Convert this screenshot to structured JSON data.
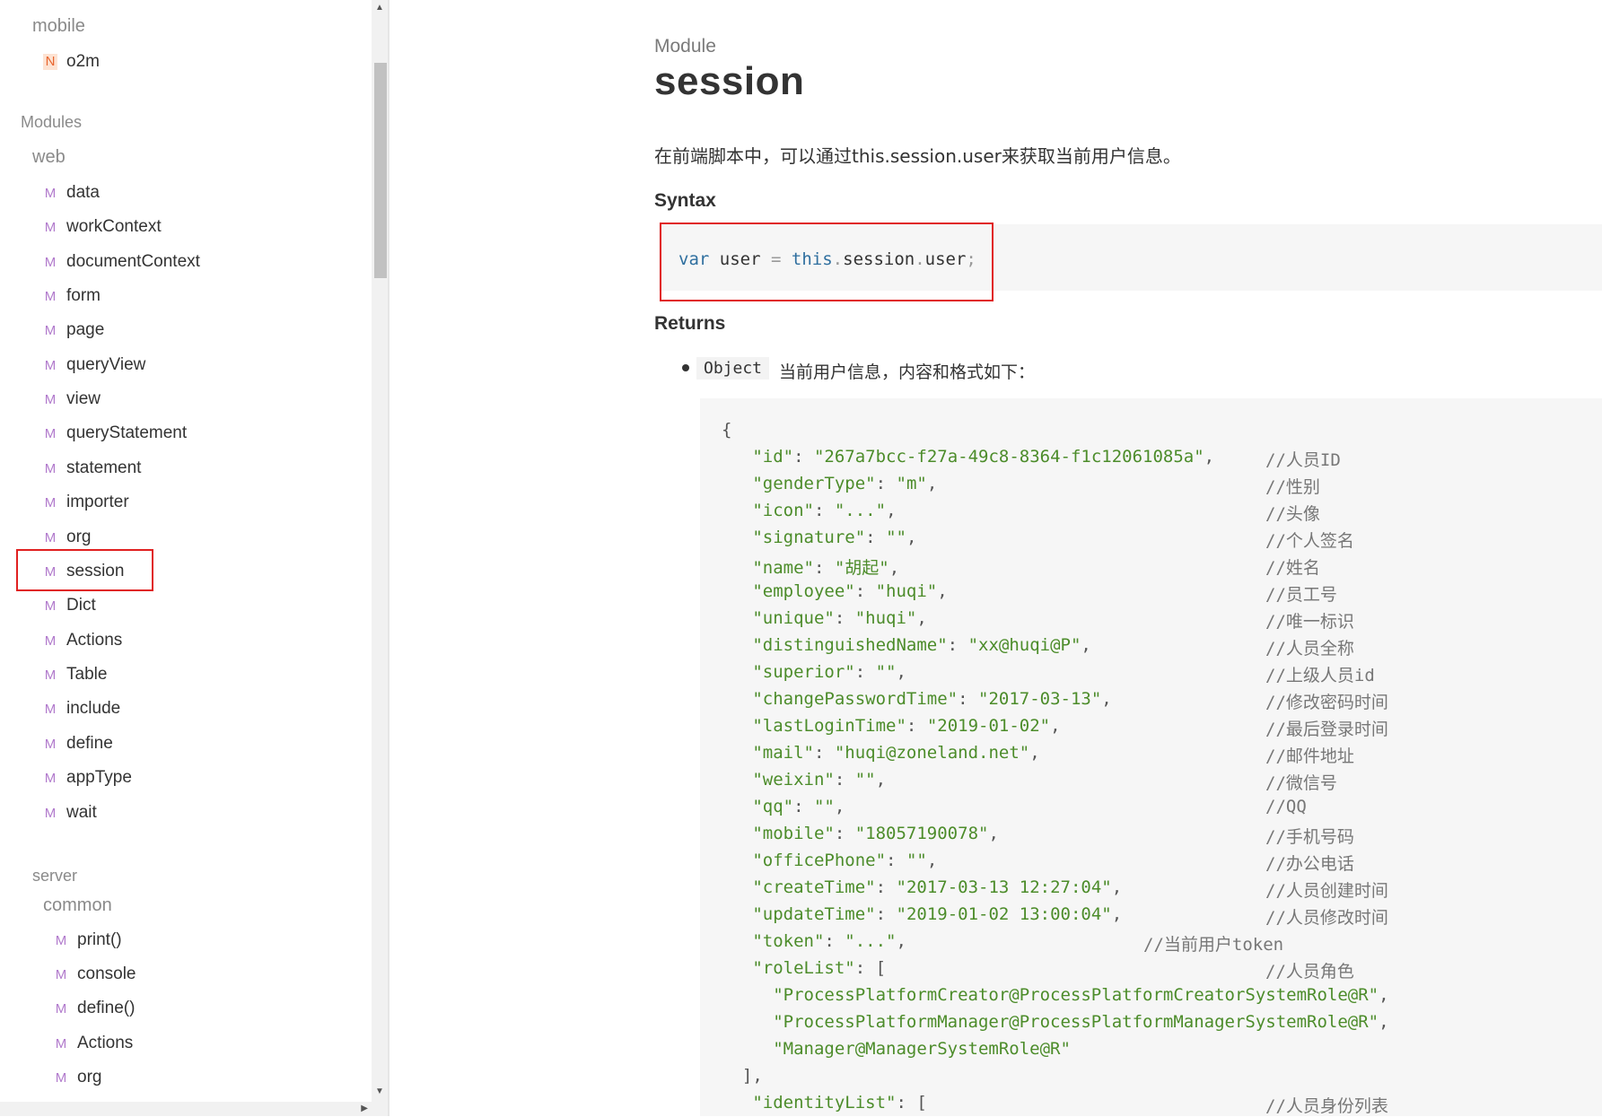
{
  "sidebar": {
    "groups": [
      {
        "heading": "mobile",
        "items": [
          {
            "badge": "N",
            "label": "o2m"
          }
        ]
      },
      {
        "heading": "Modules"
      },
      {
        "heading": "web",
        "items": [
          {
            "badge": "M",
            "label": "data"
          },
          {
            "badge": "M",
            "label": "workContext"
          },
          {
            "badge": "M",
            "label": "documentContext"
          },
          {
            "badge": "M",
            "label": "form"
          },
          {
            "badge": "M",
            "label": "page"
          },
          {
            "badge": "M",
            "label": "queryView"
          },
          {
            "badge": "M",
            "label": "view"
          },
          {
            "badge": "M",
            "label": "queryStatement"
          },
          {
            "badge": "M",
            "label": "statement"
          },
          {
            "badge": "M",
            "label": "importer"
          },
          {
            "badge": "M",
            "label": "org"
          },
          {
            "badge": "M",
            "label": "session"
          },
          {
            "badge": "M",
            "label": "Dict"
          },
          {
            "badge": "M",
            "label": "Actions"
          },
          {
            "badge": "M",
            "label": "Table"
          },
          {
            "badge": "M",
            "label": "include"
          },
          {
            "badge": "M",
            "label": "define"
          },
          {
            "badge": "M",
            "label": "appType"
          },
          {
            "badge": "M",
            "label": "wait"
          }
        ]
      },
      {
        "heading": "server"
      },
      {
        "heading": "common",
        "items": [
          {
            "badge": "M",
            "label": "print()"
          },
          {
            "badge": "M",
            "label": "console"
          },
          {
            "badge": "M",
            "label": "define()"
          },
          {
            "badge": "M",
            "label": "Actions"
          },
          {
            "badge": "M",
            "label": "org"
          }
        ]
      }
    ],
    "selected": "session"
  },
  "main": {
    "kicker": "Module",
    "title": "session",
    "description": "在前端脚本中，可以通过this.session.user来获取当前用户信息。",
    "syntax_heading": "Syntax",
    "syntax_code": {
      "kw1": "var",
      "id1": "user",
      "op": "=",
      "kw2": "this",
      "dot1": ".",
      "id2": "session",
      "dot2": ".",
      "id3": "user",
      "semi": ";"
    },
    "returns_heading": "Returns",
    "return_type": "Object",
    "return_desc": "当前用户信息，内容和格式如下：",
    "json_lines": [
      {
        "text": "{",
        "comment": ""
      },
      {
        "text": "   \"id\": \"267a7bcc-f27a-49c8-8364-f1c12061085a\",",
        "comment": "//人员ID"
      },
      {
        "text": "   \"genderType\": \"m\",",
        "comment": "//性别"
      },
      {
        "text": "   \"icon\": \"...\",",
        "comment": "//头像"
      },
      {
        "text": "   \"signature\": \"\",",
        "comment": "//个人签名"
      },
      {
        "text": "   \"name\": \"胡起\",",
        "comment": "//姓名"
      },
      {
        "text": "   \"employee\": \"huqi\",",
        "comment": "//员工号"
      },
      {
        "text": "   \"unique\": \"huqi\",",
        "comment": "//唯一标识"
      },
      {
        "text": "   \"distinguishedName\": \"xx@huqi@P\",",
        "comment": "//人员全称"
      },
      {
        "text": "   \"superior\": \"\",",
        "comment": "//上级人员id"
      },
      {
        "text": "   \"changePasswordTime\": \"2017-03-13\",",
        "comment": "//修改密码时间"
      },
      {
        "text": "   \"lastLoginTime\": \"2019-01-02\",",
        "comment": "//最后登录时间"
      },
      {
        "text": "   \"mail\": \"huqi@zoneland.net\",",
        "comment": "//邮件地址"
      },
      {
        "text": "   \"weixin\": \"\",",
        "comment": "//微信号"
      },
      {
        "text": "   \"qq\": \"\",",
        "comment": "//QQ"
      },
      {
        "text": "   \"mobile\": \"18057190078\",",
        "comment": "//手机号码"
      },
      {
        "text": "   \"officePhone\": \"\",",
        "comment": "//办公电话"
      },
      {
        "text": "   \"createTime\": \"2017-03-13 12:27:04\",",
        "comment": "//人员创建时间"
      },
      {
        "text": "   \"updateTime\": \"2019-01-02 13:00:04\",",
        "comment": "//人员修改时间"
      },
      {
        "text": "   \"token\": \"...\",",
        "comment": "//当前用户token",
        "comment_offset": "near"
      },
      {
        "text": "   \"roleList\": [",
        "comment": "//人员角色"
      },
      {
        "text": "     \"ProcessPlatformCreator@ProcessPlatformCreatorSystemRole@R\",",
        "comment": ""
      },
      {
        "text": "     \"ProcessPlatformManager@ProcessPlatformManagerSystemRole@R\",",
        "comment": ""
      },
      {
        "text": "     \"Manager@ManagerSystemRole@R\"",
        "comment": ""
      },
      {
        "text": "  ],",
        "comment": ""
      },
      {
        "text": "   \"identityList\": [",
        "comment": "//人员身份列表"
      }
    ]
  }
}
